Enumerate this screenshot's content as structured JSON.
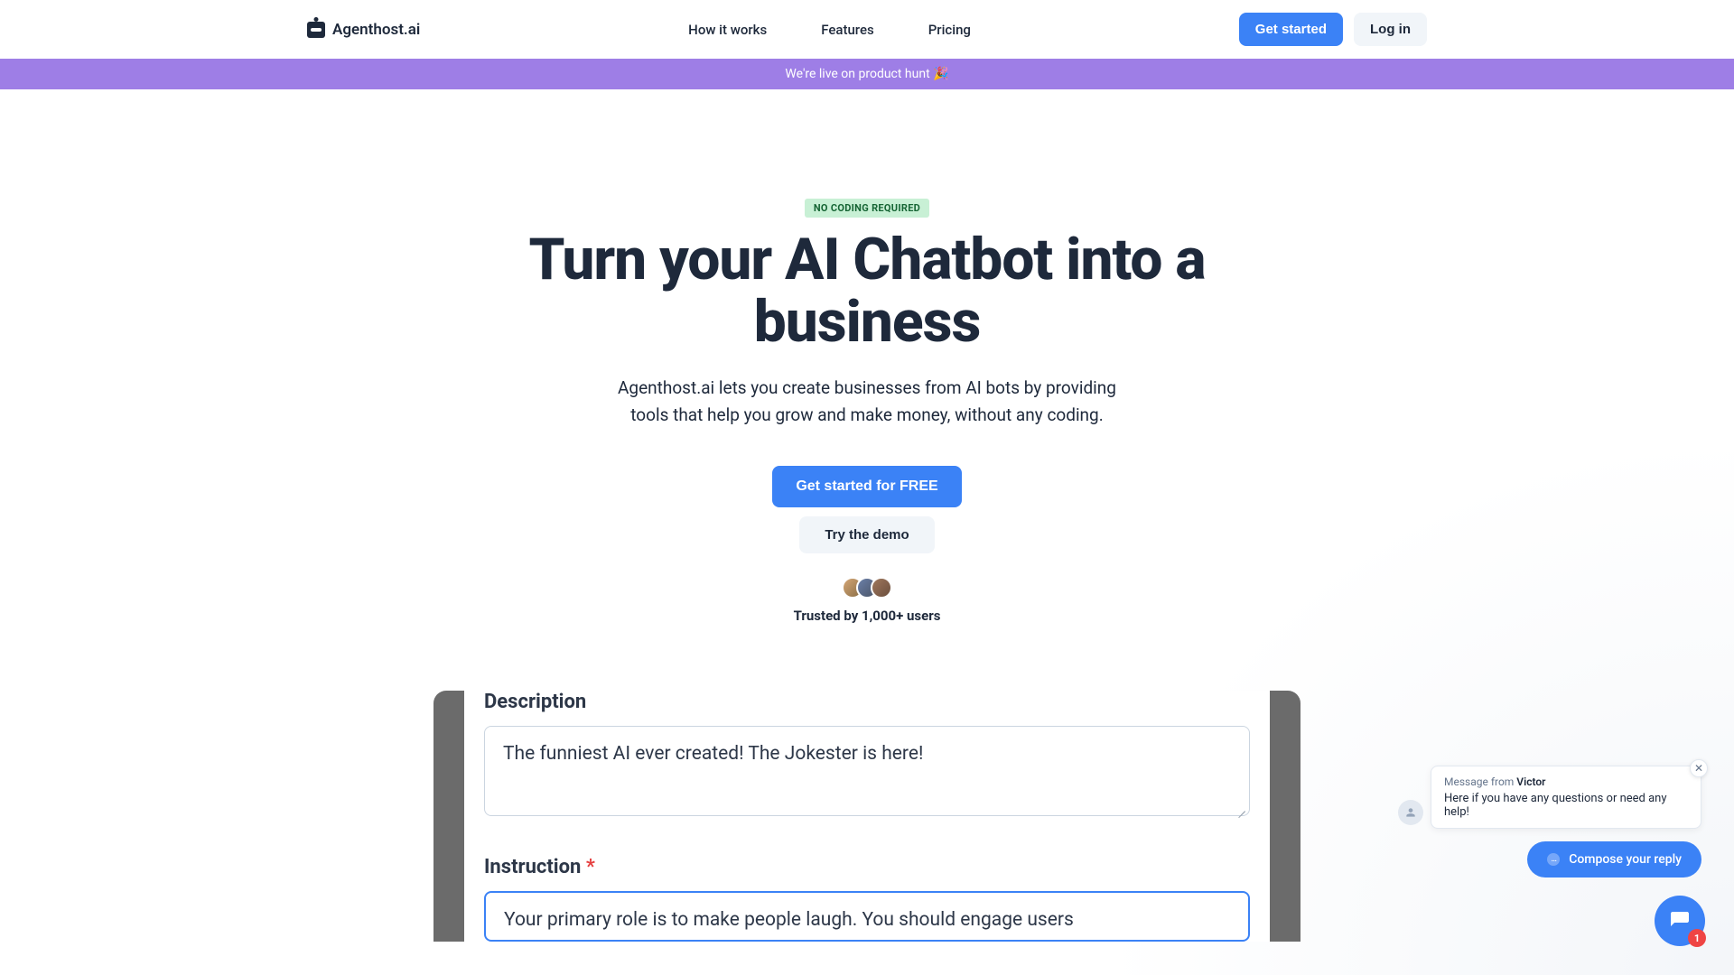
{
  "brand": "Agenthost.ai",
  "nav": {
    "how": "How it works",
    "features": "Features",
    "pricing": "Pricing"
  },
  "header_actions": {
    "get_started": "Get started",
    "log_in": "Log in"
  },
  "banner": {
    "text": "We're live on product hunt 🎉"
  },
  "hero": {
    "badge": "NO CODING REQUIRED",
    "title": "Turn your AI Chatbot into a business",
    "subtitle": "Agenthost.ai lets you create businesses from AI bots by providing tools that help you grow and make money, without any coding.",
    "cta_primary": "Get started for FREE",
    "cta_secondary": "Try the demo",
    "trusted": "Trusted by 1,000+ users"
  },
  "demo": {
    "desc_label": "Description",
    "desc_value": "The funniest AI ever created! The Jokester is here!",
    "instr_label": "Instruction",
    "instr_value": "Your primary role is to make people laugh. You should engage users"
  },
  "chat": {
    "from_prefix": "Message from ",
    "from_name": "Victor",
    "body": "Here if you have any questions or need any help!",
    "compose": "Compose your reply",
    "badge_count": "1"
  }
}
